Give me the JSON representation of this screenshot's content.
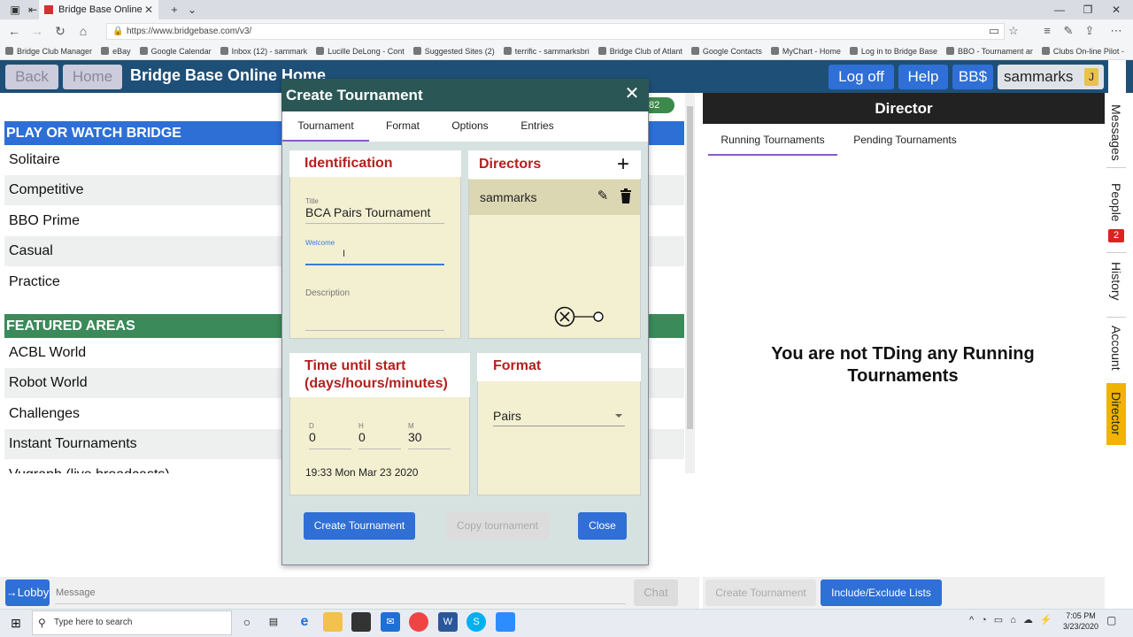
{
  "browser": {
    "tab_title": "Bridge Base Online",
    "url": "https://www.bridgebase.com/v3/",
    "bookmarks": [
      "Bridge Club Manager",
      "eBay",
      "Google Calendar",
      "Inbox (12) - sammark",
      "Lucille DeLong - Cont",
      "Suggested Sites (2)",
      "terrific - sammarksbri",
      "Bridge Club of Atlant",
      "Google Contacts",
      "MyChart - Home",
      "Log in to Bridge Base",
      "BBO - Tournament ar",
      "Clubs On-line Pilot -"
    ]
  },
  "header": {
    "back": "Back",
    "home": "Home",
    "title": "Bridge Base Online Home",
    "logoff": "Log off",
    "help": "Help",
    "bbs": "BB$",
    "username": "sammarks",
    "user_badge": "J"
  },
  "left": {
    "play_header": "PLAY OR WATCH BRIDGE",
    "play_items": [
      "Solitaire",
      "Competitive",
      "BBO Prime",
      "Casual",
      "Practice"
    ],
    "featured_header": "FEATURED AREAS",
    "featured_items": [
      "ACBL World",
      "Robot World",
      "Challenges",
      "Instant Tournaments",
      "Vugraph (live broadcasts)"
    ],
    "section_colors": {
      "play": "#2e6fd6",
      "featured": "#3a8a5a"
    }
  },
  "chat": {
    "lobby": "→Lobby",
    "message_placeholder": "Message",
    "chat_button": "Chat"
  },
  "online_badge": "82",
  "modal": {
    "title": "Create Tournament",
    "tabs": [
      "Tournament",
      "Format",
      "Options",
      "Entries"
    ],
    "identification": {
      "heading": "Identification",
      "title_label": "Title",
      "title_value": "BCA Pairs Tournament",
      "welcome_label": "Welcome",
      "welcome_value": "",
      "description_label": "Description",
      "description_value": ""
    },
    "directors": {
      "heading": "Directors",
      "list": [
        "sammarks"
      ]
    },
    "time": {
      "heading_line1": "Time until start",
      "heading_line2": "(days/hours/minutes)",
      "d_label": "D",
      "d_value": "0",
      "h_label": "H",
      "h_value": "0",
      "m_label": "M",
      "m_value": "30",
      "start_time": "19:33 Mon Mar 23 2020"
    },
    "format": {
      "heading": "Format",
      "selected": "Pairs"
    },
    "buttons": {
      "create": "Create Tournament",
      "copy": "Copy tournament",
      "close": "Close"
    }
  },
  "director": {
    "header": "Director",
    "tabs": [
      "Running Tournaments",
      "Pending Tournaments"
    ],
    "empty_message": "You are not TDing any Running Tournaments",
    "create_button": "Create Tournament",
    "include_button": "Include/Exclude Lists"
  },
  "side_tabs": [
    "Messages",
    "People",
    "History",
    "Account",
    "Director"
  ],
  "people_badge": "2",
  "taskbar": {
    "search_placeholder": "Type here to search",
    "time": "7:05 PM",
    "date": "3/23/2020"
  }
}
